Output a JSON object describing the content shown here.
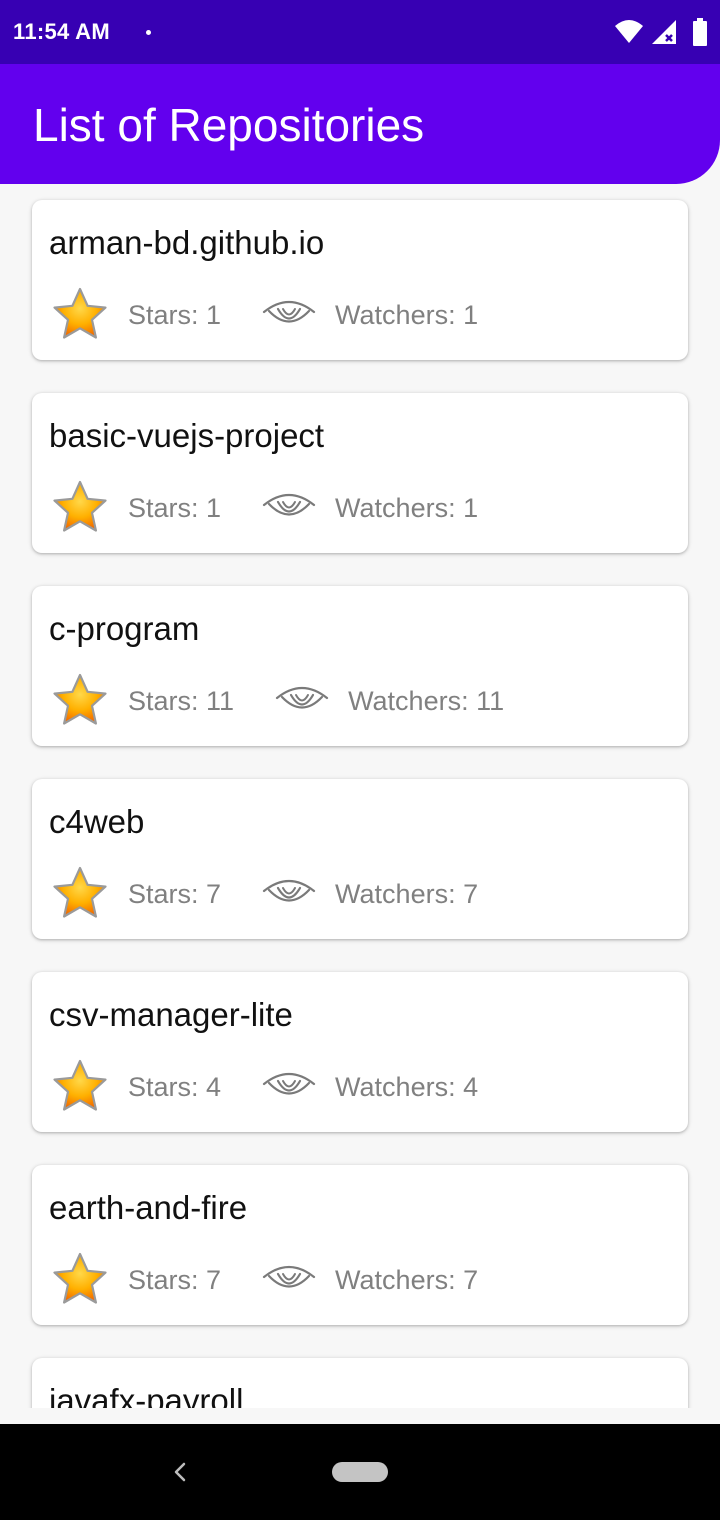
{
  "status_bar": {
    "time": "11:54 AM",
    "icons": [
      "notification-dot",
      "wifi-icon",
      "signal-icon",
      "battery-icon"
    ]
  },
  "app_bar": {
    "title": "List of Repositories",
    "color": "#6200ee"
  },
  "repositories": [
    {
      "name": "arman-bd.github.io",
      "stars": "Stars: 1",
      "watchers": "Watchers: 1"
    },
    {
      "name": "basic-vuejs-project",
      "stars": "Stars: 1",
      "watchers": "Watchers: 1"
    },
    {
      "name": "c-program",
      "stars": "Stars: 11",
      "watchers": "Watchers: 11"
    },
    {
      "name": "c4web",
      "stars": "Stars: 7",
      "watchers": "Watchers: 7"
    },
    {
      "name": "csv-manager-lite",
      "stars": "Stars: 4",
      "watchers": "Watchers: 4"
    },
    {
      "name": "earth-and-fire",
      "stars": "Stars: 7",
      "watchers": "Watchers: 7"
    },
    {
      "name": "javafx-payroll",
      "stars": "",
      "watchers": ""
    }
  ],
  "nav_bar": {
    "icons": [
      "back-icon",
      "home-pill"
    ]
  }
}
